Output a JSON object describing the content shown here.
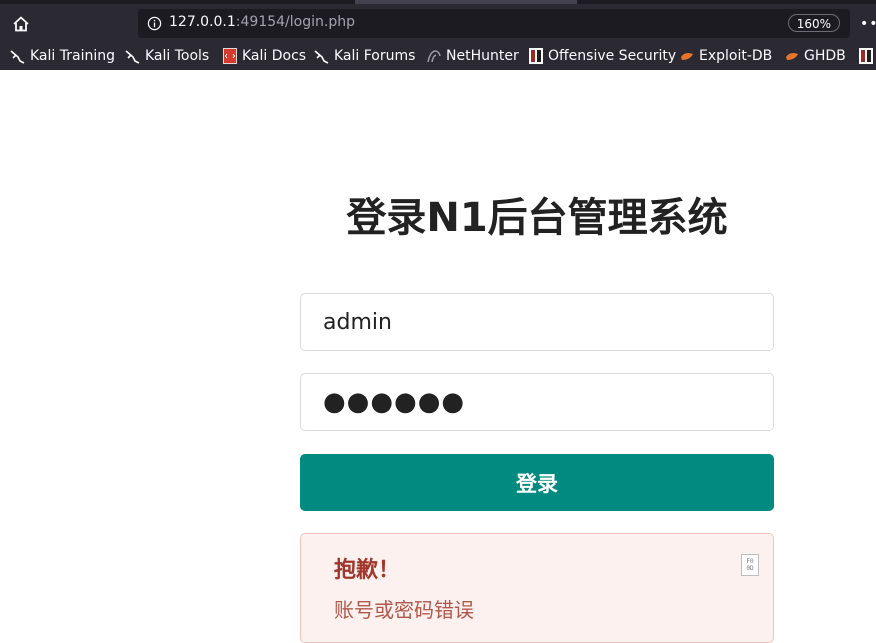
{
  "browser": {
    "url_host": "127.0.0.1",
    "url_rest": ":49154/login.php",
    "zoom": "160%",
    "bookmarks": [
      {
        "label": "Kali Training",
        "icon": "kali-dragon-icon"
      },
      {
        "label": "Kali Tools",
        "icon": "kali-dragon-icon"
      },
      {
        "label": "Kali Docs",
        "icon": "kali-docs-icon"
      },
      {
        "label": "Kali Forums",
        "icon": "kali-dragon-icon"
      },
      {
        "label": "NetHunter",
        "icon": "nethunter-icon"
      },
      {
        "label": "Offensive Security",
        "icon": "offsec-icon"
      },
      {
        "label": "Exploit-DB",
        "icon": "exploit-db-icon"
      },
      {
        "label": "GHDB",
        "icon": "ghdb-icon"
      }
    ]
  },
  "page": {
    "title": "登录N1后台管理系统",
    "username_value": "admin",
    "password_mask": "●●●●●●",
    "login_label": "登录",
    "alert": {
      "title": "抱歉！",
      "message": "账号或密码错误",
      "close_glyph": "F0 0D"
    }
  },
  "colors": {
    "button": "#008a80",
    "alert_bg": "#fdf1ef",
    "alert_title": "#a1362b",
    "alert_text": "#b2584b",
    "chrome": "#2b2a33"
  }
}
